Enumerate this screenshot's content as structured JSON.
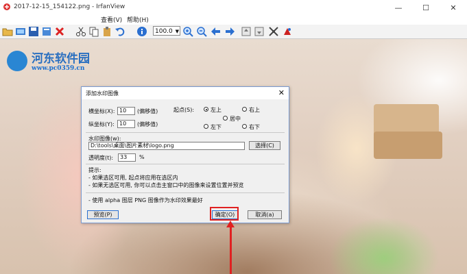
{
  "window": {
    "title": "2017-12-15_154122.png - IrfanView",
    "minimize": "—",
    "maximize": "☐",
    "close": "✕"
  },
  "menu": {
    "view": "查看(V)",
    "help": "帮助(H)"
  },
  "toolbar": {
    "zoom": "100.0"
  },
  "watermark": {
    "site_name": "河东软件园",
    "url": "www.pc0359.cn"
  },
  "dialog": {
    "title": "添加水印图像",
    "close": "✕",
    "x_label": "横坐标(X):",
    "x_value": "10",
    "x_hint": "(偏移值)",
    "y_label": "纵坐标(Y):",
    "y_value": "10",
    "y_hint": "(偏移值)",
    "start_label": "起点(S):",
    "pos_top_left": "左上",
    "pos_top_right": "右上",
    "pos_center": "居中",
    "pos_bottom_left": "左下",
    "pos_bottom_right": "右下",
    "selected_position": "左上",
    "image_label": "水印图像(w):",
    "image_path": "D:\\tools\\桌面\\图片素材\\logo.png",
    "browse_button": "选择(C)",
    "opacity_label": "透明度(t):",
    "opacity_value": "33",
    "opacity_unit": "%",
    "tips_title": "提示:",
    "tip1": "- 如果选区可用, 起点将应用在选区内",
    "tip2": "- 如果无选区可用, 你可以点击主窗口中的图像来设置位置并预览",
    "tip3": "- 使用 alpha 图层 PNG 图像作为水印效果最好",
    "preview_button": "预览(P)",
    "ok_button": "确定(O)",
    "cancel_button": "取消(a)"
  },
  "colors": {
    "annotation_red": "#e02020",
    "dialog_border": "#7a9ad0",
    "watermark_blue": "#2a6fc0"
  }
}
